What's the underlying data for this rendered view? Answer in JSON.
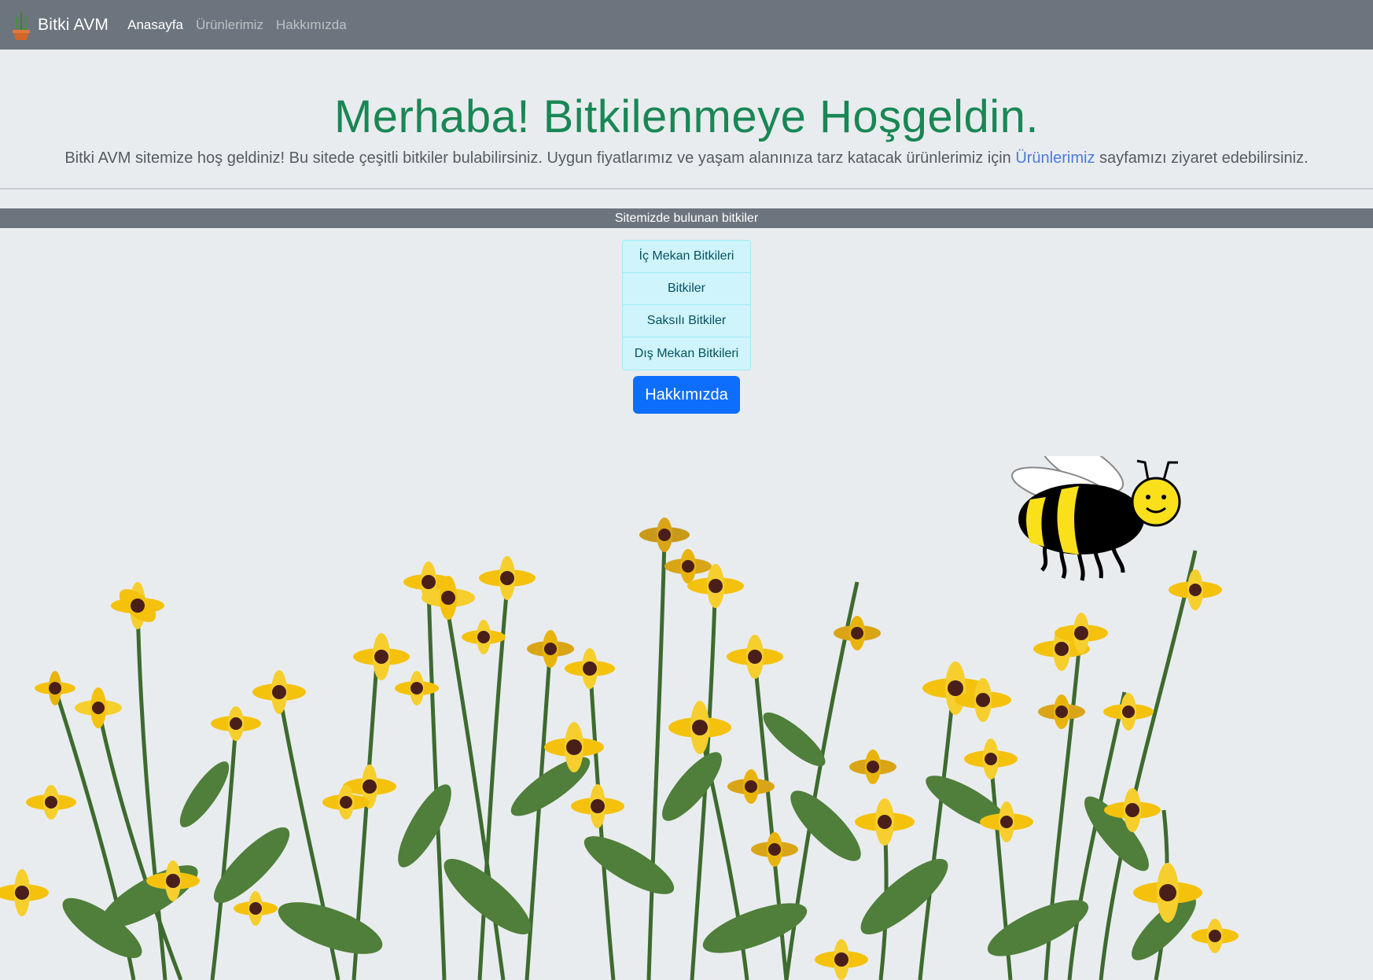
{
  "navbar": {
    "brand": "Bitki AVM",
    "links": [
      {
        "label": "Anasayfa",
        "active": true
      },
      {
        "label": "Ürünlerimiz",
        "active": false
      },
      {
        "label": "Hakkımızda",
        "active": false
      }
    ]
  },
  "hero": {
    "title": "Merhaba! Bitkilenmeye Hoşgeldin.",
    "lead_before": "Bitki AVM sitemize hoş geldiniz! Bu sitede çeşitli bitkiler bulabilirsiniz. Uygun fiyatlarımız ve yaşam alanınıza tarz katacak ürünlerimiz için ",
    "lead_link": "Ürünlerimiz",
    "lead_after": " sayfamızı ziyaret edebilirsiniz."
  },
  "section": {
    "title": "Sitemizde bulunan bitkiler",
    "categories": [
      "İç Mekan Bitkileri",
      "Bitkiler",
      "Saksılı Bitkiler",
      "Dış Mekan Bitkileri"
    ],
    "button_label": "Hakkımızda"
  },
  "colors": {
    "navbar": "#6c757d",
    "background": "#e9ecef",
    "title": "#198754",
    "link": "#4a7bd9",
    "list_bg": "#cff4fc",
    "list_text": "#055160",
    "primary_button": "#0d6efd"
  },
  "icons": {
    "brand_logo": "potted-cactus-icon"
  }
}
